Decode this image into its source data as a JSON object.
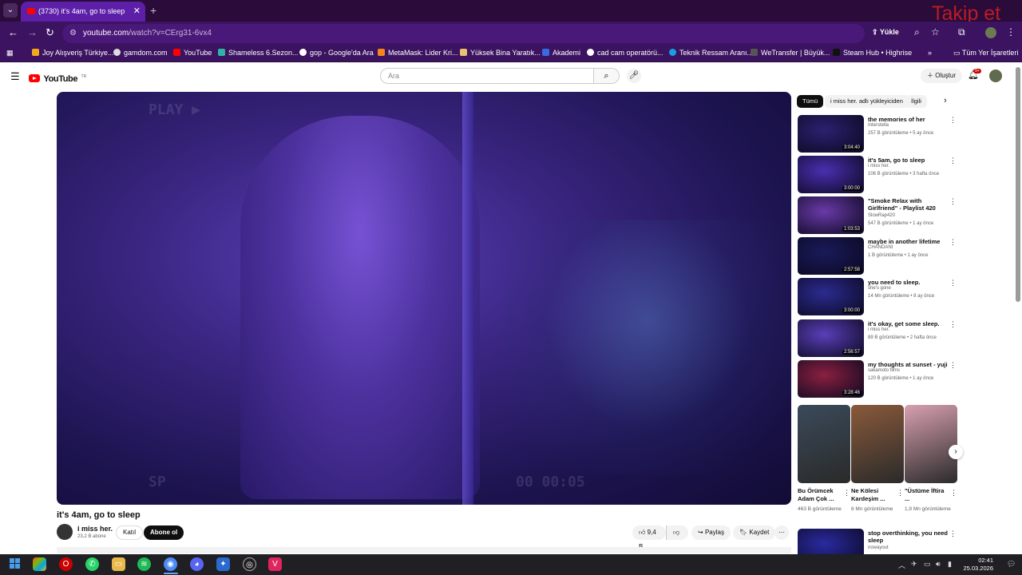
{
  "browser": {
    "tab_title": "(3730) it's 4am, go to sleep - Yo",
    "url_host": "youtube.com",
    "url_rest": "/watch?v=CErg31-6vx4",
    "upload_label": "Yükle",
    "watermark": "Takip et",
    "bookmarks": [
      "Joy Alışveriş Türkiye...",
      "gamdom.com",
      "YouTube",
      "Shameless 6.Sezon...",
      "gop - Google'da Ara",
      "MetaMask: Lider Kri...",
      "Yüksek Bina Yaratık...",
      "Akademi",
      "cad cam operatörü...",
      "Teknik Ressam Aranı...",
      "WeTransfer | Büyük...",
      "Steam Hub • Highrise"
    ],
    "all_bookmarks": "Tüm Yer İşaretleri"
  },
  "youtube": {
    "logo_text": "YouTube",
    "country_code": "TR",
    "search_placeholder": "Ara",
    "create_label": "Oluştur",
    "notif_count": "9+"
  },
  "video": {
    "title": "it's 4am, go to sleep",
    "channel": "i miss her.",
    "subscribers": "23,2 B abone",
    "join_label": "Katıl",
    "subscribe_label": "Abone ol",
    "likes": "9,4 B",
    "share_label": "Paylaş",
    "save_label": "Kaydet",
    "overlay_play": "PLAY ▶",
    "overlay_sp": "SP",
    "overlay_time": "00 00:05"
  },
  "chips": [
    "Tümü",
    "i miss her. adlı yükleyiciden",
    "İlgili"
  ],
  "recommendations": [
    {
      "title": "the memories of her",
      "channel": "Interstella",
      "meta": "257 B görüntüleme • 5 ay önce",
      "duration": "3:04:40",
      "thumb_color": "#2b2170"
    },
    {
      "title": "it's 5am, go to sleep",
      "channel": "i miss her.",
      "meta": "106 B görüntüleme • 3 hafta önce",
      "duration": "3:00:00",
      "thumb_color": "#4a2fb0"
    },
    {
      "title": "\"Smoke Relax with Girlfriend\" - Playlist 420 Vibe Music • Ston...",
      "channel": "SlowRap420",
      "meta": "547 B görüntüleme • 1 ay önce",
      "duration": "1:03:53",
      "thumb_color": "#6a3aa8"
    },
    {
      "title": "maybe in another lifetime",
      "channel": "CHANDANI",
      "meta": "1 B görüntüleme • 1 ay önce",
      "duration": "2:57:58",
      "thumb_color": "#1a1a5a"
    },
    {
      "title": "you need to sleep.",
      "channel": "she's gone",
      "meta": "14 Mn görüntüleme • 8 ay önce",
      "duration": "3:00:00",
      "thumb_color": "#2b2b90"
    },
    {
      "title": "it's okay, get some sleep.",
      "channel": "i miss her.",
      "meta": "89 B görüntüleme • 2 hafta önce",
      "duration": "2:56:57",
      "thumb_color": "#5a3fb8"
    },
    {
      "title": "my thoughts at sunset - yuji",
      "channel": "sakamoto films",
      "meta": "120 B görüntüleme • 1 ay önce",
      "duration": "3:28:46",
      "thumb_color": "#8a2040"
    },
    {
      "title": "stop overthinking, you need sleep",
      "channel": "nowayout",
      "meta": "",
      "duration": "",
      "thumb_color": "#2a2aa0"
    }
  ],
  "shorts": [
    {
      "title": "Bu Örümcek Adam Çok ...",
      "views": "463 B görüntüleme",
      "thumb_color": "#3a4a5a"
    },
    {
      "title": "Ne Kölesi Kardeşim ...",
      "views": "6 Mn görüntüleme",
      "thumb_color": "#8a5a3a"
    },
    {
      "title": "\"Üstüme İftira ...",
      "views": "1,9 Mn görüntüleme",
      "thumb_color": "#d8a0b0"
    }
  ],
  "taskbar": {
    "time": "02:41",
    "date": "25.03.2026"
  },
  "colors": {
    "browser_frame": "#3b1360",
    "youtube_red": "#ff0000",
    "taskbar": "#1f1f24"
  }
}
